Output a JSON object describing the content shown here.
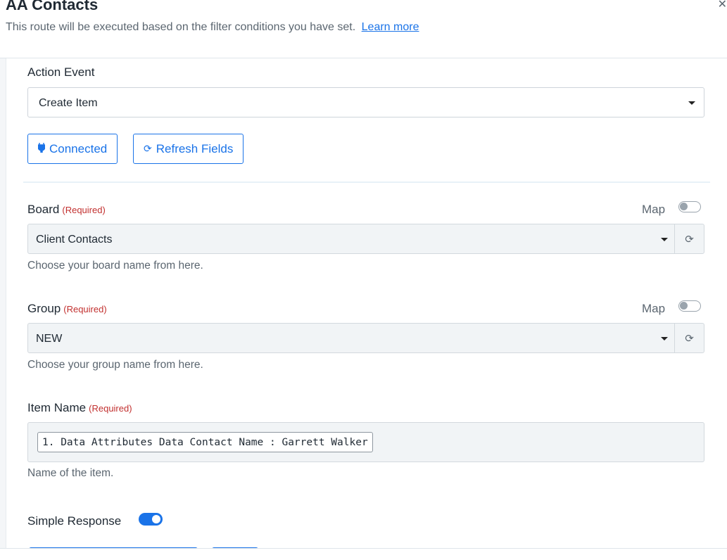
{
  "header": {
    "title": "AA Contacts",
    "subtitle": "This route will be executed based on the filter conditions you have set.",
    "learn_more": "Learn more"
  },
  "action_event": {
    "label": "Action Event",
    "selected": "Create Item"
  },
  "buttons": {
    "connected": "Connected",
    "refresh_fields": "Refresh Fields"
  },
  "required_text": "(Required)",
  "map_label": "Map",
  "board": {
    "label": "Board",
    "selected": "Client Contacts",
    "hint": "Choose your board name from here."
  },
  "group": {
    "label": "Group",
    "selected": "NEW",
    "hint": "Choose your group name from here."
  },
  "item_name": {
    "label": "Item Name",
    "chip": "1. Data Attributes Data Contact Name : Garrett Walker",
    "hint": "Name of the item."
  },
  "simple_response": {
    "label": "Simple Response",
    "enabled": true
  },
  "colors": {
    "accent": "#1a73e8",
    "required": "#c2302f"
  }
}
